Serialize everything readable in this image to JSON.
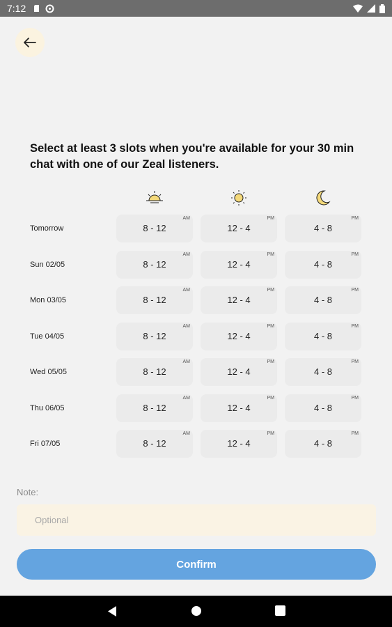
{
  "status": {
    "time": "7:12"
  },
  "prompt": "Select at least 3 slots when you're available for your 30 min chat with one of our Zeal listeners.",
  "periods": [
    {
      "icon": "sunrise-icon"
    },
    {
      "icon": "sun-icon"
    },
    {
      "icon": "moon-icon"
    }
  ],
  "rows": [
    {
      "label": "Tomorrow",
      "slots": [
        {
          "range": "8 - 12",
          "ampm": "AM"
        },
        {
          "range": "12 - 4",
          "ampm": "PM"
        },
        {
          "range": "4 - 8",
          "ampm": "PM"
        }
      ]
    },
    {
      "label": "Sun 02/05",
      "slots": [
        {
          "range": "8 - 12",
          "ampm": "AM"
        },
        {
          "range": "12 - 4",
          "ampm": "PM"
        },
        {
          "range": "4 - 8",
          "ampm": "PM"
        }
      ]
    },
    {
      "label": "Mon 03/05",
      "slots": [
        {
          "range": "8 - 12",
          "ampm": "AM"
        },
        {
          "range": "12 - 4",
          "ampm": "PM"
        },
        {
          "range": "4 - 8",
          "ampm": "PM"
        }
      ]
    },
    {
      "label": "Tue 04/05",
      "slots": [
        {
          "range": "8 - 12",
          "ampm": "AM"
        },
        {
          "range": "12 - 4",
          "ampm": "PM"
        },
        {
          "range": "4 - 8",
          "ampm": "PM"
        }
      ]
    },
    {
      "label": "Wed 05/05",
      "slots": [
        {
          "range": "8 - 12",
          "ampm": "AM"
        },
        {
          "range": "12 - 4",
          "ampm": "PM"
        },
        {
          "range": "4 - 8",
          "ampm": "PM"
        }
      ]
    },
    {
      "label": "Thu 06/05",
      "slots": [
        {
          "range": "8 - 12",
          "ampm": "AM"
        },
        {
          "range": "12 - 4",
          "ampm": "PM"
        },
        {
          "range": "4 - 8",
          "ampm": "PM"
        }
      ]
    },
    {
      "label": "Fri 07/05",
      "slots": [
        {
          "range": "8 - 12",
          "ampm": "AM"
        },
        {
          "range": "12 - 4",
          "ampm": "PM"
        },
        {
          "range": "4 - 8",
          "ampm": "PM"
        }
      ]
    }
  ],
  "note": {
    "label": "Note:",
    "placeholder": "Optional"
  },
  "confirm_label": "Confirm",
  "colors": {
    "accent": "#64a4e0",
    "note_bg": "#faf3e4",
    "back_bg": "#fbf3e0"
  }
}
